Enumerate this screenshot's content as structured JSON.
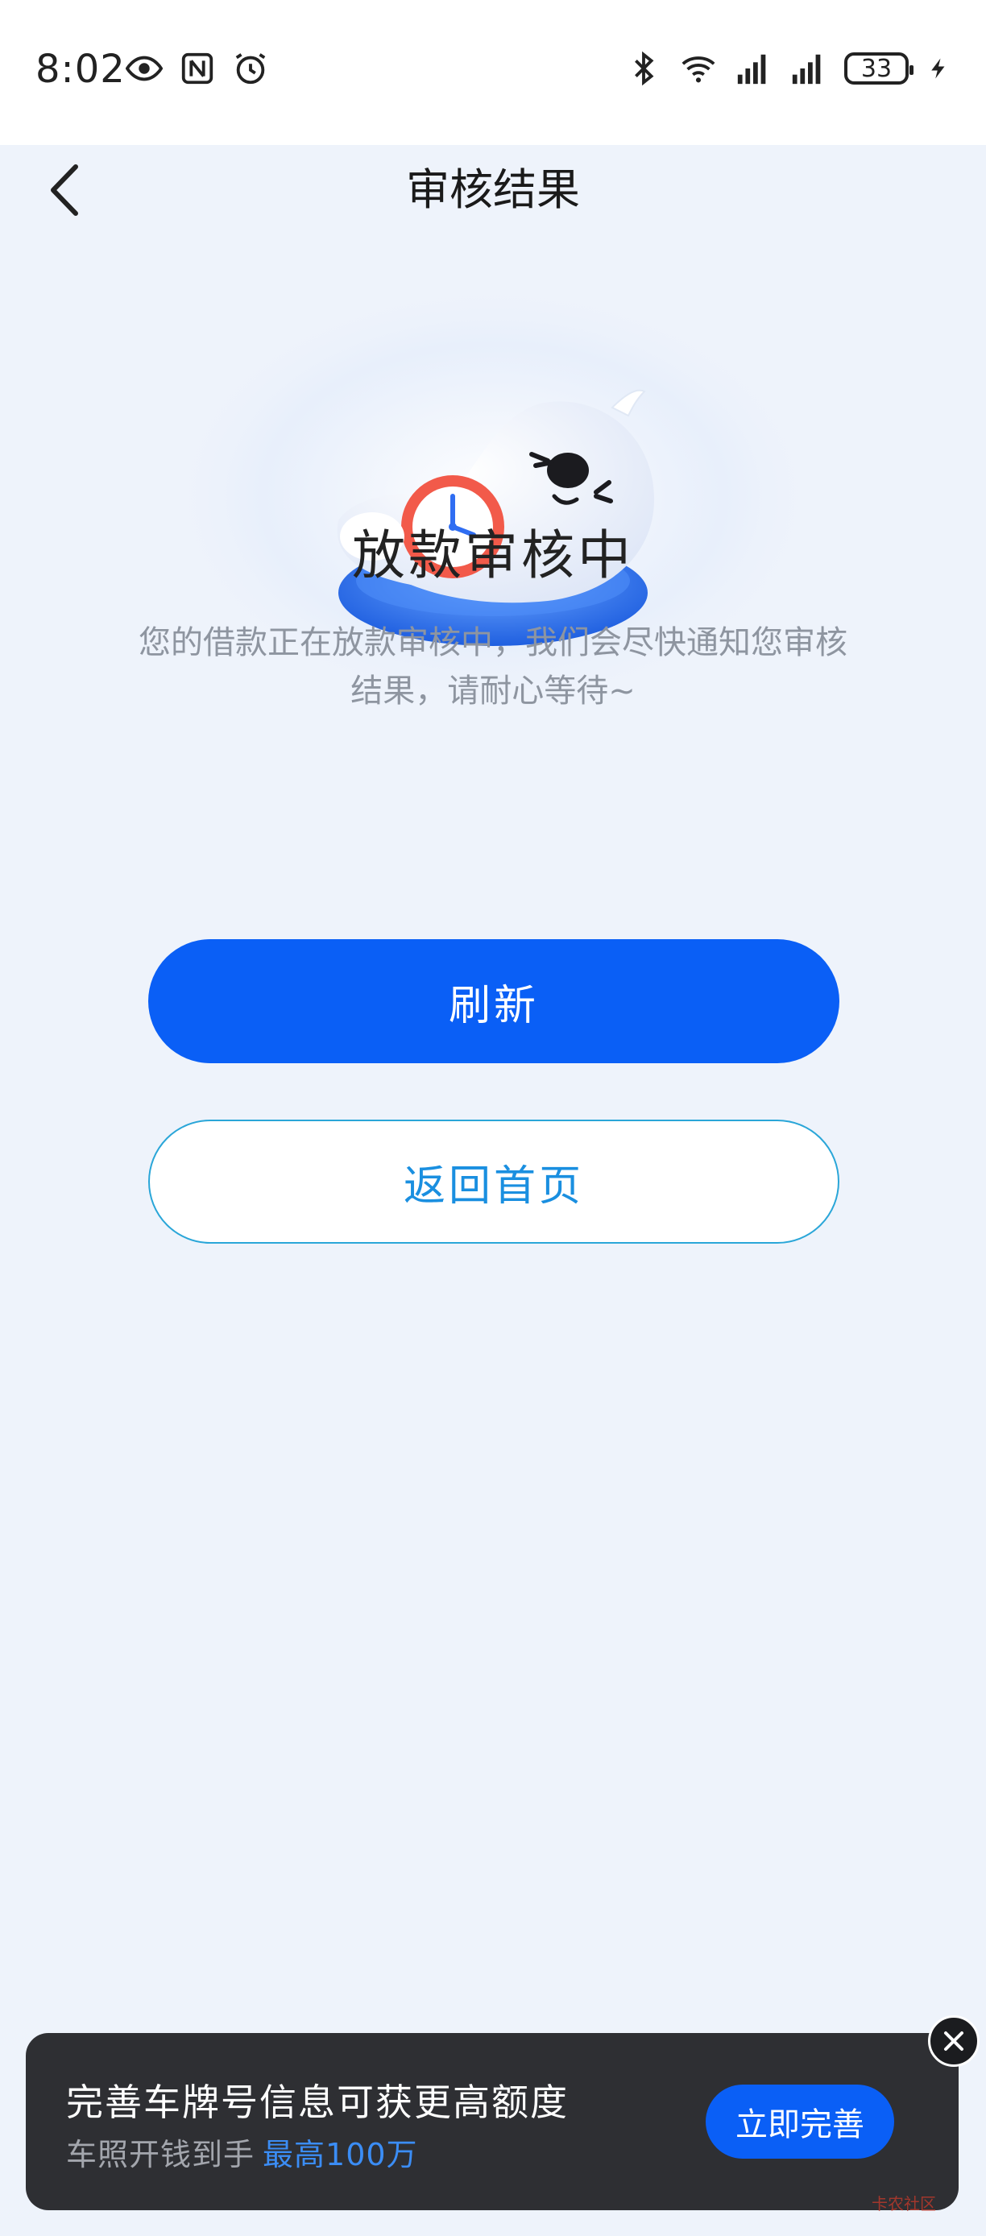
{
  "status_bar": {
    "time": "8:02",
    "battery": "33",
    "icons": [
      "eye-icon",
      "nfc-icon",
      "alarm-icon",
      "bluetooth-icon",
      "wifi-icon",
      "signal-icon",
      "signal-icon",
      "charging-icon"
    ]
  },
  "nav": {
    "title": "审核结果",
    "back_icon": "chevron-left-icon"
  },
  "illustration": {
    "icon": "seal-clock-illustration"
  },
  "status": {
    "title": "放款审核中",
    "desc": "您的借款正在放款审核中，我们会尽快通知您审核结果，请耐心等待~"
  },
  "actions": {
    "refresh_label": "刷新",
    "home_label": "返回首页"
  },
  "banner": {
    "title": "完善车牌号信息可获更高额度",
    "sub_text": "车照开钱到手",
    "sub_highlight": "最高100万",
    "cta_label": "立即完善",
    "close_icon": "close-icon"
  },
  "watermark": {
    "text": "卡农社区"
  },
  "colors": {
    "primary": "#0a5ff6",
    "background": "#eef3fb",
    "banner_bg": "#2e2f33",
    "secondary_text": "#8e95a0"
  }
}
